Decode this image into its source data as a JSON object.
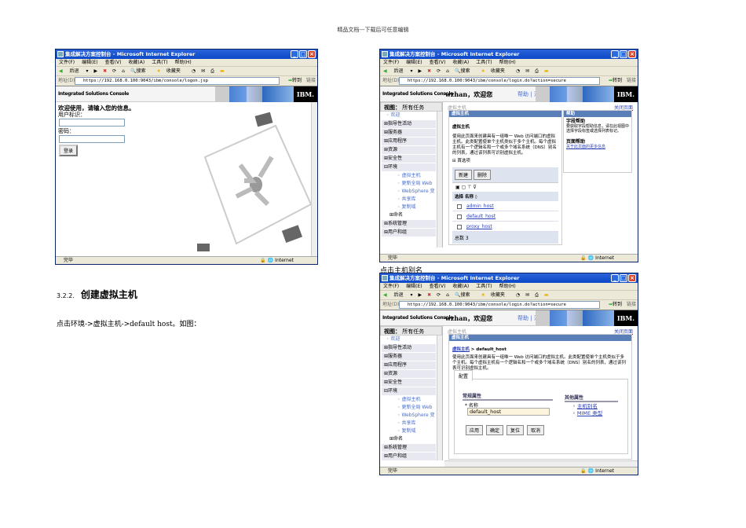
{
  "doc": {
    "header": "精品文档---下载后可任意编辑",
    "section_num": "3.2.2.",
    "section_title": "创建虚拟主机",
    "instruction": "点击环境->虚拟主机->default host。如图：",
    "caption": "点击主机别名"
  },
  "browser": {
    "title": "集成解决方案控制台 - Microsoft Internet Explorer",
    "menu": [
      "文件(F)",
      "编辑(E)",
      "查看(V)",
      "收藏(A)",
      "工具(T)",
      "帮助(H)"
    ],
    "back": "后退",
    "search": "搜索",
    "favorites": "收藏夹",
    "address_label": "地址(D)",
    "go": "转到",
    "links": "链接",
    "status_done": "完毕",
    "zone": "Internet",
    "console_title": "Integrated Solutions Console",
    "logo": "IBM."
  },
  "login": {
    "url": "https://192.168.0.100:9043/ibm/console/logon.jsp",
    "welcome": "欢迎使用，请输入您的信息。",
    "user_label": "用户标识：",
    "password_label": "密码：",
    "login_button": "登录"
  },
  "console": {
    "url": "https://192.168.0.100:9043/ibm/console/login.do?action=secure",
    "user_welcome": "wzhan，欢迎您",
    "help": "帮助",
    "logout": "注销",
    "view_label": "视图：",
    "view_value": "所有任务",
    "welcome": "欢迎",
    "nav": [
      "指导性活动",
      "服务器",
      "应用程序",
      "资源",
      "安全性",
      "环境"
    ],
    "env_sub": [
      "虚拟主机",
      "更新全局 Web",
      "WebSphere 变",
      "共享库",
      "复制域"
    ],
    "naming": "命名",
    "nav_after": [
      "系统管理",
      "用户和组"
    ],
    "breadcrumb": "虚拟主机",
    "close_page": "关闭页面"
  },
  "list": {
    "portlet_title": "虚拟主机",
    "heading": "虚拟主机",
    "description": "使用此页面来创建具有一组唯一 Web 访问端口的虚拟主机。此类配置使单个主机类似于多个主机。每个虚拟主机有一个逻辑名和一个或多个域名系统（DNS）别名的列表，通过该列表可识别虚拟主机。",
    "preferences": "首选项",
    "new": "新建",
    "delete": "删除",
    "col_select": "选择",
    "col_name": "名称 ◊",
    "rows": [
      "admin_host",
      "default_host",
      "proxy_host"
    ],
    "total": "总数 3",
    "help_title": "帮助",
    "field_help": "字段帮助",
    "field_help_text": "要获取字段帮助信息，请在此视图中选择字段标签或选择列表标记。",
    "page_help": "页面帮助",
    "page_help_link": "关于此页面的更多信息"
  },
  "detail": {
    "portlet_title": "虚拟主机",
    "crumb_link": "虚拟主机",
    "crumb_current": "> default_host",
    "description": "使用此页面来创建具有一组唯一 Web 访问端口的虚拟主机。此类配置使单个主机类似于多个主机。每个虚拟主机有一个逻辑名和一个或多个域名系统（DNS）别名的列表，通过该列表可识别虚拟主机。",
    "tab": "配置",
    "general": "常规属性",
    "name_label": "* 名称",
    "name_value": "default_host",
    "other": "其他属性",
    "links": [
      "主机别名",
      "MIME 类型"
    ],
    "buttons": [
      "应用",
      "确定",
      "复位",
      "取消"
    ]
  }
}
